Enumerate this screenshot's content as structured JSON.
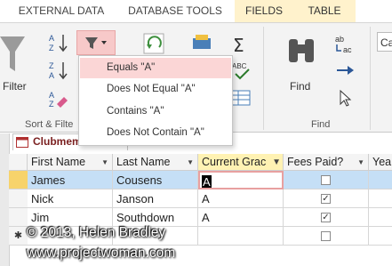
{
  "ribbon_tabs": [
    "EXTERNAL DATA",
    "DATABASE TOOLS",
    "FIELDS",
    "TABLE"
  ],
  "ribbon": {
    "filter_label": "Filter",
    "sort_filter_group": "Sort & Filte",
    "find_label": "Find",
    "find_group": "Find",
    "find_right_fragment": "Ca",
    "accent": "#fff2cc"
  },
  "filter_menu": {
    "items": [
      {
        "label": "Equals \"A\"",
        "selected": true
      },
      {
        "label": "Does Not Equal \"A\"",
        "selected": false
      },
      {
        "label": "Contains \"A\"",
        "selected": false
      },
      {
        "label": "Does Not Contain \"A\"",
        "selected": false
      }
    ],
    "selected_color": "#fbd6d6"
  },
  "table": {
    "tab_label": "Clubmembers",
    "columns": [
      "First Name",
      "Last Name",
      "Current Grac",
      "Fees Paid?",
      "Yea"
    ],
    "rows": [
      {
        "first": "James",
        "last": "Cousens",
        "grade": "A",
        "fees": false,
        "selected": true
      },
      {
        "first": "Nick",
        "last": "Janson",
        "grade": "A",
        "fees": true,
        "selected": false
      },
      {
        "first": "Jim",
        "last": "Southdown",
        "grade": "A",
        "fees": true,
        "selected": false
      },
      {
        "first": "",
        "last": "",
        "grade": "",
        "fees": false,
        "selected": false
      }
    ],
    "new_row_marker": "✱",
    "selected_row_color": "#c5dff6"
  },
  "watermark": {
    "line1": "© 2013, Helen Bradley",
    "line2": "www.projectwoman.com"
  }
}
